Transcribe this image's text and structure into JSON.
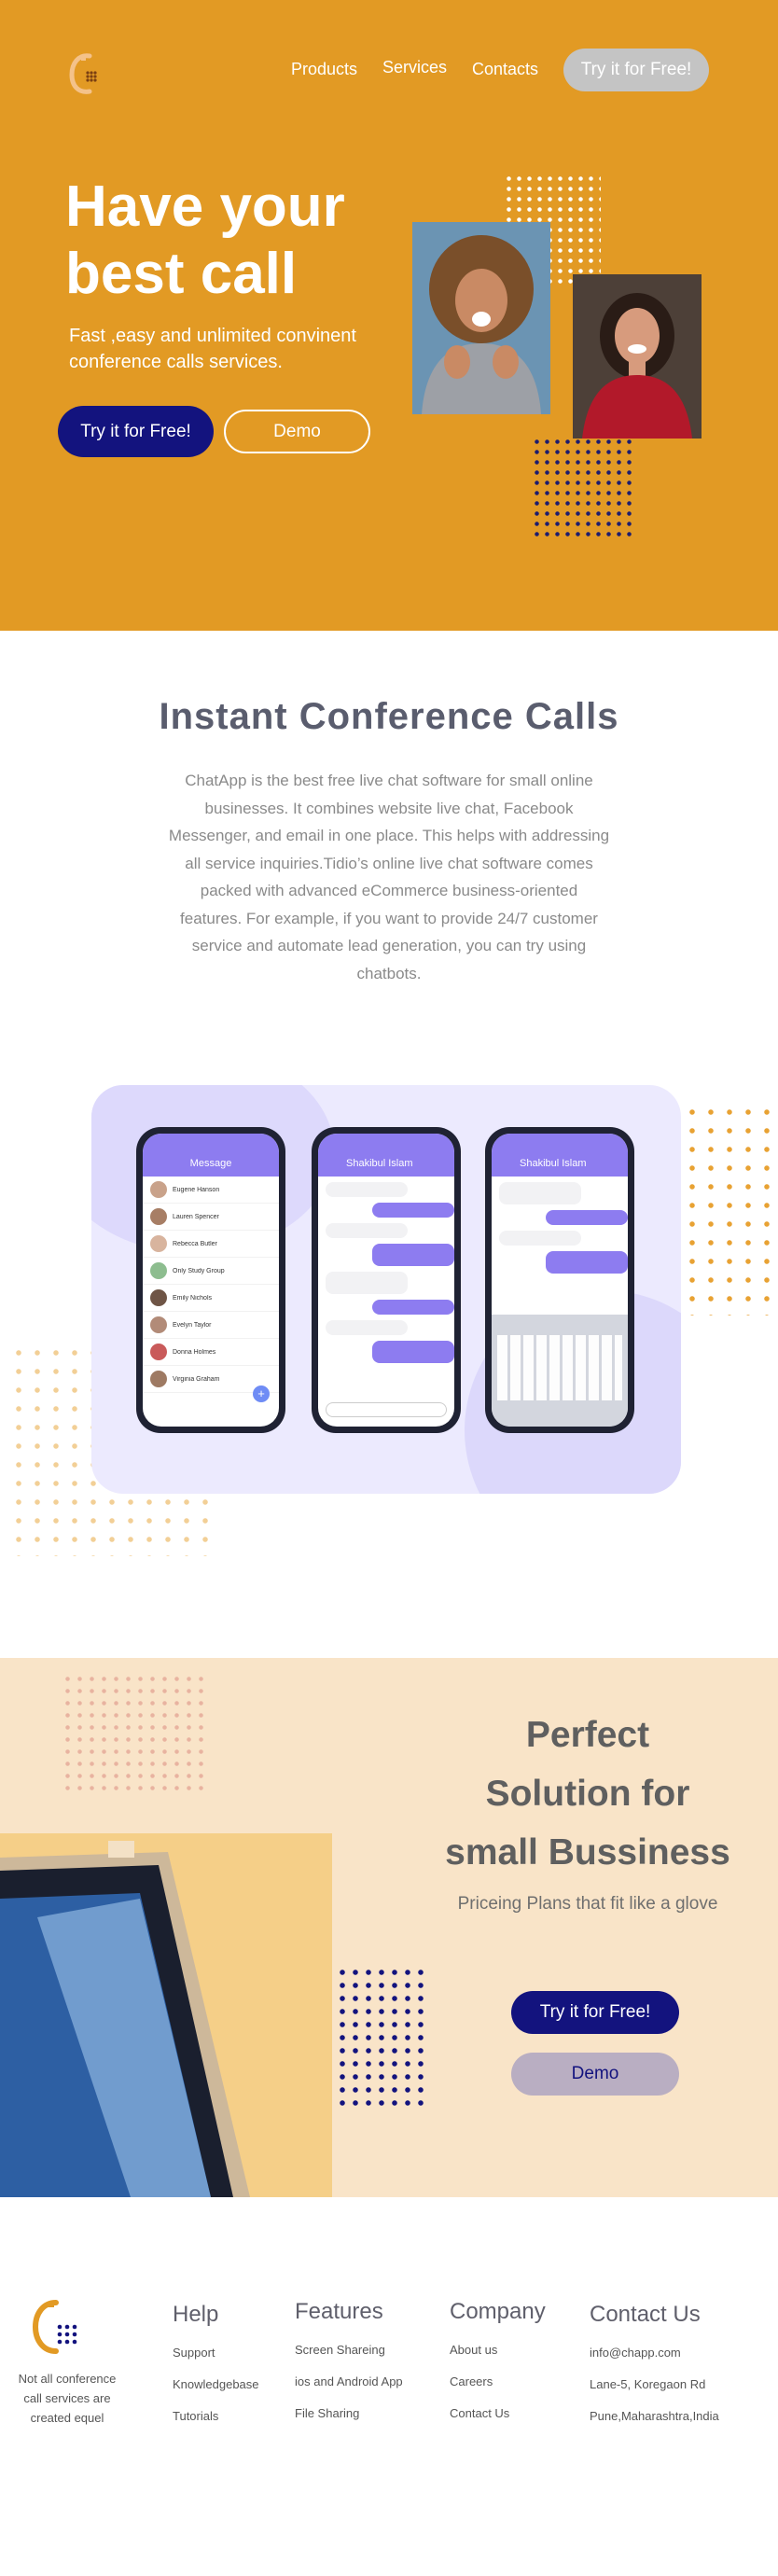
{
  "nav": {
    "products": "Products",
    "services": "Services",
    "contacts": "Contacts",
    "cta": "Try it for Free!"
  },
  "hero": {
    "title_line1": "Have your",
    "title_line2": "best call",
    "subtitle_line1": "Fast ,easy  and unlimited convinent",
    "subtitle_line2": "conference calls services.",
    "primary_button": "Try it for Free!",
    "secondary_button": "Demo"
  },
  "instant": {
    "title": "Instant  Conference Calls",
    "body_lines": [
      "ChatApp is the best free live chat software for small online",
      "businesses. It combines website live chat, Facebook",
      "Messenger, and email in one place. This helps with addressing",
      "all service inquiries.Tidio’s online live chat software comes",
      "packed with advanced eCommerce business-oriented",
      "features. For example, if you want to provide 24/7 customer",
      "service and automate lead generation, you can try using",
      "chatbots."
    ]
  },
  "phones": {
    "list_header": "Message",
    "chat_header": "Shakibul Islam",
    "contacts": [
      "Eugene Hanson",
      "Lauren Spencer",
      "Rebecca Butler",
      "Only Study Group",
      "Emily Nichols",
      "Evelyn Taylor",
      "Donna Holmes",
      "Virginia Graham"
    ]
  },
  "solution": {
    "title_line1": "Perfect",
    "title_line2": "Solution for",
    "title_line3": "small Bussiness",
    "subtitle": "Priceing Plans that fit like a glove",
    "primary_button": "Try it for Free!",
    "secondary_button": "Demo"
  },
  "footer": {
    "tagline_lines": [
      "Not all conference",
      "call services are",
      "created equel"
    ],
    "help": {
      "heading": "Help",
      "items": [
        "Support",
        "Knowledgebase",
        "Tutorials"
      ]
    },
    "features": {
      "heading": "Features",
      "items": [
        "Screen Shareing",
        "ios and Android App",
        "File Sharing"
      ]
    },
    "company": {
      "heading": "Company",
      "items": [
        "About us",
        "Careers",
        "Contact Us"
      ]
    },
    "contact": {
      "heading": "Contact Us",
      "items": [
        "info@chapp.com",
        "Lane-5, Koregaon Rd",
        "Pune,Maharashtra,India"
      ]
    }
  },
  "colors": {
    "hero_orange": "#e29a24",
    "navy": "#13137e",
    "lavender": "#8d7cf0",
    "cream": "#f9e4c8"
  }
}
